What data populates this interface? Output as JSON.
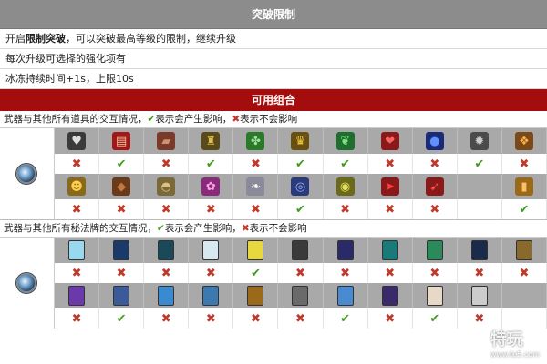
{
  "section1": {
    "title": "突破限制",
    "line1_pre": "开启",
    "line1_bold": "限制突破",
    "line1_post": "，可以突破最高等级的限制，继续升级",
    "line2": "每次升级可选择的强化项有",
    "line3": "冰冻持续时间+1s，上限10s"
  },
  "section2": {
    "title": "可用组合",
    "items_note_pre": "武器与其他所有道具的交互情况，",
    "items_note_mid": "表示会产生影响，",
    "items_note_post": "表示不会影响",
    "cards_note_pre": "武器与其他所有秘法牌的交互情况，",
    "cards_note_mid": "表示会产生影响，",
    "cards_note_post": "表示不会影响",
    "check_glyph": "✔",
    "cross_glyph": "✖"
  },
  "colors": {
    "header_gray": "#8c8c8c",
    "header_red": "#a30d0d",
    "check": "#3f9b1f",
    "cross": "#c0392b"
  },
  "items_row1": {
    "icons": [
      {
        "name": "heart-shield-icon",
        "glyph": "♥",
        "bg": "#3a3a3a",
        "fg": "#ddd"
      },
      {
        "name": "red-book-icon",
        "glyph": "▤",
        "bg": "#a01818",
        "fg": "#f1c6a0"
      },
      {
        "name": "bandage-icon",
        "glyph": "▰",
        "bg": "#7a3a2a",
        "fg": "#d19070"
      },
      {
        "name": "golden-armor-icon",
        "glyph": "♜",
        "bg": "#5a4a1a",
        "fg": "#e0c050"
      },
      {
        "name": "clover-icon",
        "glyph": "✤",
        "bg": "#2a7a2a",
        "fg": "#9ce09c"
      },
      {
        "name": "crown-frame-icon",
        "glyph": "♛",
        "bg": "#6a5010",
        "fg": "#f0c840"
      },
      {
        "name": "green-feather-icon",
        "glyph": "❦",
        "bg": "#1e6e2e",
        "fg": "#7fe07f"
      },
      {
        "name": "broken-heart-icon",
        "glyph": "❤",
        "bg": "#8a1a1a",
        "fg": "#ff6060"
      },
      {
        "name": "blue-orb-icon",
        "glyph": "●",
        "bg": "#1a2a7a",
        "fg": "#6090ff"
      },
      {
        "name": "gear-skull-icon",
        "glyph": "✹",
        "bg": "#4a4a4a",
        "fg": "#cccccc"
      },
      {
        "name": "colorful-gem-icon",
        "glyph": "❖",
        "bg": "#7a4a1a",
        "fg": "#ffb040"
      }
    ],
    "marks": [
      "off",
      "on",
      "off",
      "on",
      "off",
      "on",
      "on",
      "off",
      "off",
      "on",
      "off"
    ]
  },
  "items_row2": {
    "icons": [
      {
        "name": "golden-mask-icon",
        "glyph": "☻",
        "bg": "#8a6a1a",
        "fg": "#ffd050"
      },
      {
        "name": "brown-box-icon",
        "glyph": "◆",
        "bg": "#6a3a1a",
        "fg": "#c07a40"
      },
      {
        "name": "shell-helmet-icon",
        "glyph": "◓",
        "bg": "#7a6a3a",
        "fg": "#e0c080"
      },
      {
        "name": "pink-skull-icon",
        "glyph": "✿",
        "bg": "#8a2a7a",
        "fg": "#ffa0e0"
      },
      {
        "name": "white-wing-icon",
        "glyph": "❧",
        "bg": "#8a8a9a",
        "fg": "#ffffff"
      },
      {
        "name": "blue-ring-icon",
        "glyph": "◎",
        "bg": "#2a3a7a",
        "fg": "#9ab0ff"
      },
      {
        "name": "gold-ring-icon",
        "glyph": "◉",
        "bg": "#6a6a1a",
        "fg": "#e8e060"
      },
      {
        "name": "red-arrow-icon",
        "glyph": "➤",
        "bg": "#8a1a1a",
        "fg": "#ff4040"
      },
      {
        "name": "red-dart-icon",
        "glyph": "➹",
        "bg": "#8a1a1a",
        "fg": "#ff5050"
      },
      {
        "name": "empty-slot-icon",
        "glyph": "",
        "bg": "transparent",
        "fg": "#000"
      },
      {
        "name": "gold-bar-icon",
        "glyph": "▮",
        "bg": "#9a6a1a",
        "fg": "#ffc060"
      }
    ],
    "marks": [
      "off",
      "off",
      "off",
      "off",
      "off",
      "on",
      "off",
      "off",
      "off",
      "",
      "on"
    ]
  },
  "cards_row1": {
    "icons": [
      {
        "name": "ice-card-icon",
        "bg": "#9ad8f0"
      },
      {
        "name": "dark-tower-card-icon",
        "bg": "#1a3a6a"
      },
      {
        "name": "eye-card-icon",
        "bg": "#1a4a5a"
      },
      {
        "name": "sun-card-icon",
        "bg": "#d8e8f0"
      },
      {
        "name": "yellow-card-icon",
        "bg": "#e8d840"
      },
      {
        "name": "crack-card-icon",
        "bg": "#3a3a3a"
      },
      {
        "name": "night-card-icon",
        "bg": "#2a2a6a"
      },
      {
        "name": "teal-card-icon",
        "bg": "#1a7a7a"
      },
      {
        "name": "green-card-icon",
        "bg": "#2a8a5a"
      },
      {
        "name": "star-card-icon",
        "bg": "#1a2a4a"
      },
      {
        "name": "golden-card-icon",
        "bg": "#8a6a2a"
      }
    ],
    "marks": [
      "off",
      "off",
      "off",
      "off",
      "on",
      "off",
      "off",
      "off",
      "off",
      "off",
      "off"
    ]
  },
  "cards_row2": {
    "icons": [
      {
        "name": "purple-card-icon",
        "bg": "#6a3aaa"
      },
      {
        "name": "lantern-card-icon",
        "bg": "#3a5a9a"
      },
      {
        "name": "blue-glow-card-icon",
        "bg": "#3a8ad0"
      },
      {
        "name": "crystal-card-icon",
        "bg": "#3a7ab0"
      },
      {
        "name": "chest-card-icon",
        "bg": "#9a6a1a"
      },
      {
        "name": "gray-card-icon",
        "bg": "#6a6a6a"
      },
      {
        "name": "lightning-card-icon",
        "bg": "#4a8ad0"
      },
      {
        "name": "figure-card-icon",
        "bg": "#3a2a6a"
      },
      {
        "name": "fire-card-icon",
        "bg": "#e8d8c8"
      },
      {
        "name": "hidden-card-icon",
        "bg": "#cccccc"
      },
      {
        "name": "empty-card-slot",
        "bg": "transparent"
      }
    ],
    "marks": [
      "off",
      "on",
      "off",
      "off",
      "off",
      "off",
      "on",
      "off",
      "on",
      "off",
      ""
    ]
  },
  "watermark": {
    "main": "特玩",
    "sub": "www.te5.com"
  }
}
